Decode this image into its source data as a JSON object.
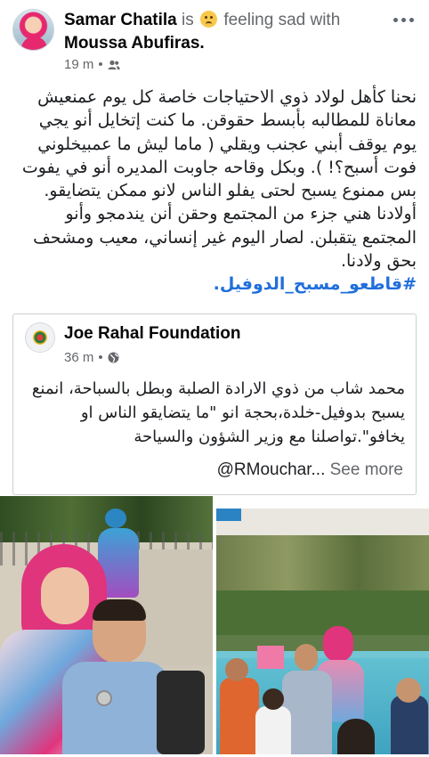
{
  "post": {
    "author": "Samar Chatila",
    "is_text": "is",
    "feeling_text": "feeling sad with",
    "tagged": "Moussa Abufiras.",
    "time": "19 m",
    "privacy_icon": "friends-icon",
    "paragraphs": [
      "نحنا كأهل لولاد ذوي الاحتياجات خاصة كل يوم عمنعيش معاناة للمطالبه بأبسط حقوقن. ما كنت إتخايل أنو يجي يوم يوقف أبني عجنب ويقلي ( ماما ليش ما عمبيخلوني فوت أسبح؟! ). وبكل وقاحه جاوبت المديره أنو في يفوت بس ممنوع يسبح لحتى يفلو الناس لانو ممكن يتضايقو.",
      "أولادنا هني جزء من المجتمع وحقن أنن يندمجو وأنو المجتمع يتقبلن. لصار اليوم غير إنساني، معيب ومشحف  بحق ولادنا."
    ],
    "hashtags": "#قاطعو_مسبح_الدوفيل."
  },
  "shared": {
    "page_name": "Joe Rahal Foundation",
    "time": "36 m",
    "privacy_icon": "globe-icon",
    "text": "محمد شاب من ذوي الارادة الصلبة وبطل بالسباحة، انمنع يسبح بدوفيل-خلدة،بحجة انو \"ما يتضايقو الناس او يخافو\".تواصلنا مع وزير الشؤون والسياحة",
    "mention": "@RMouchar...",
    "see_more": "See more"
  },
  "photos": [
    {
      "icon": "photo-mother-and-son"
    },
    {
      "icon": "photo-pool-group"
    }
  ]
}
